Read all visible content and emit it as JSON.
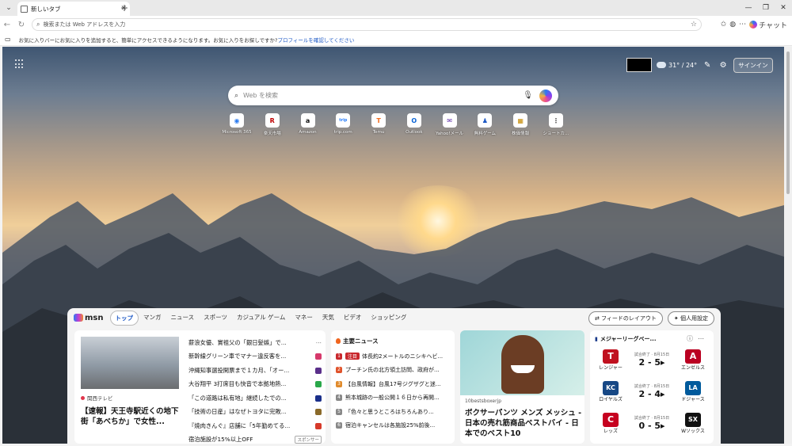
{
  "browser": {
    "tab_title": "新しいタブ",
    "address_placeholder": "検索または Web アドレスを入力",
    "copilot_label": "チャット",
    "fav_message": "お気に入りバーにお気に入りを追加すると、簡単にアクセスできるようになります。お気に入りをお探しですか?",
    "fav_link": "プロフィールを確認してください"
  },
  "page": {
    "weather": "31° / 24°",
    "signin": "サインイン",
    "search_placeholder": "Web を検索"
  },
  "quicklinks": [
    {
      "label": "Microsoft 365",
      "glyph": "◉",
      "color": "#2b7bf0"
    },
    {
      "label": "楽天市場",
      "glyph": "R",
      "color": "#bf0000"
    },
    {
      "label": "Amazon",
      "glyph": "a",
      "color": "#111111"
    },
    {
      "label": "trip.com",
      "glyph": "trip",
      "color": "#287dfa"
    },
    {
      "label": "Temu",
      "glyph": "T",
      "color": "#f36b1c"
    },
    {
      "label": "Outlook",
      "glyph": "O",
      "color": "#0a64d6"
    },
    {
      "label": "Yahoo!メール",
      "glyph": "✉",
      "color": "#5f2ea8"
    },
    {
      "label": "無料ゲーム",
      "glyph": "♟",
      "color": "#1a56c4"
    },
    {
      "label": "株価情報",
      "glyph": "▦",
      "color": "#c48a00"
    },
    {
      "label": "ショートカ...",
      "glyph": "⋮",
      "color": "#444444"
    }
  ],
  "feed": {
    "brand": "msn",
    "tabs": [
      "トップ",
      "マンガ",
      "ニュース",
      "スポーツ",
      "カジュアル ゲーム",
      "マネー",
      "天気",
      "ビデオ",
      "ショッピング"
    ],
    "layout_btn": "フィードのレイアウト",
    "personalize_btn": "個人用設定"
  },
  "card1": {
    "source": "関西テレビ",
    "headline": "【速報】天王寺駅近くの地下街「あべちか」で女性...",
    "items": [
      {
        "text": "薪浪女優、實祖父の「銀日髪嫉」で...",
        "badge": "",
        "color": ""
      },
      {
        "text": "新幹線グリーン車でマナー違反客を...",
        "badge": "■",
        "color": "#d6396b"
      },
      {
        "text": "沖縄知事選投開票まで１カ月、「オー...",
        "badge": "■",
        "color": "#5a2f8a"
      },
      {
        "text": "大谷翔平 3打席目も快音で本拠地熱...",
        "badge": "■",
        "color": "#2aa84a"
      },
      {
        "text": "「この道路は私有地」継続したでの...",
        "badge": "■",
        "color": "#1a2f8a"
      },
      {
        "text": "「技術の日産」はなぜトヨタに完敗...",
        "badge": "■",
        "color": "#8a6a2a"
      },
      {
        "text": "『焼肉きんぐ』店舗に「5年勤めてる...",
        "badge": "■",
        "color": "#d63a2a"
      },
      {
        "text": "宿泊施設が15%以上OFF",
        "badge": "スポンサー",
        "color": ""
      }
    ]
  },
  "card2": {
    "title": "主要ニュース",
    "items": [
      {
        "num": "1",
        "tag": "注目",
        "text": "体長約2メートルのニシキヘビ...",
        "color": "#c9282d"
      },
      {
        "num": "2",
        "tag": "",
        "text": "プーチン氏の北方領土訪問、政府が...",
        "color": "#e0532b"
      },
      {
        "num": "3",
        "tag": "",
        "text": "【台風情報】台風17号ジグザグと迷...",
        "color": "#e08a2b"
      },
      {
        "num": "4",
        "tag": "",
        "text": "熊本城跡の一般公開１６日から再開...",
        "color": "#888888"
      },
      {
        "num": "5",
        "tag": "",
        "text": "「色々と思うところはちろんあり...",
        "color": "#888888"
      },
      {
        "num": "6",
        "tag": "",
        "text": "宿泊キャンセルは各施設25%前後...",
        "color": "#888888"
      }
    ]
  },
  "card3": {
    "source": "10bestsboxerjp",
    "headline": "ボクサーパンツ メンズ メッシュ - 日本の売れ筋商品ベストバイ - 日本でのベスト10"
  },
  "card4": {
    "title": "メジャーリーグベー...",
    "games": [
      {
        "home": "レンジャー",
        "home_logo": "T",
        "home_color": "#c0111f",
        "away": "エンゼルス",
        "away_logo": "A",
        "away_color": "#ba0021",
        "status": "試合終了 · 8月15日",
        "score": "2 - 5▸"
      },
      {
        "home": "ロイヤルズ",
        "home_logo": "KC",
        "home_color": "#174885",
        "away": "ドジャース",
        "away_logo": "LA",
        "away_color": "#005a9c",
        "status": "試合終了 · 8月15日",
        "score": "2 - 4▸"
      },
      {
        "home": "レッズ",
        "home_logo": "C",
        "home_color": "#c6011f",
        "away": "Wソックス",
        "away_logo": "SX",
        "away_color": "#111111",
        "status": "試合終了 · 8月15日",
        "score": "0 - 5▸"
      }
    ]
  }
}
